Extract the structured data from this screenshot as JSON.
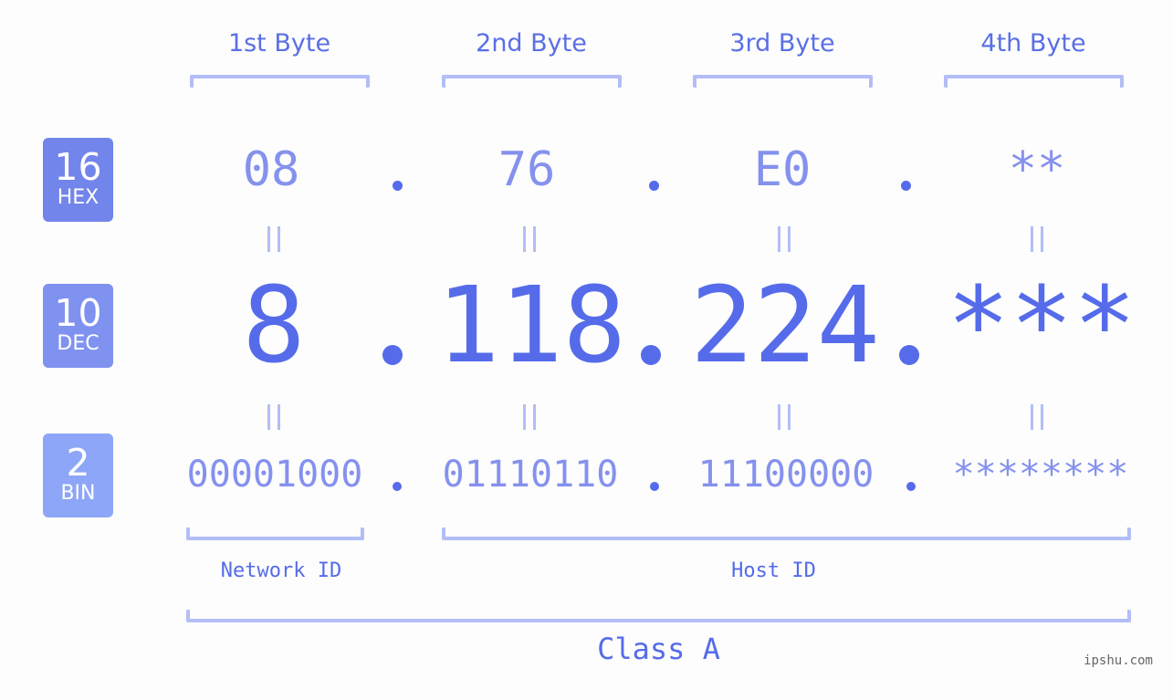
{
  "ip_display": {
    "byte_headers": [
      "1st Byte",
      "2nd Byte",
      "3rd Byte",
      "4th Byte"
    ],
    "bases": [
      {
        "number": "16",
        "label": "HEX",
        "color": "#7285eb"
      },
      {
        "number": "10",
        "label": "DEC",
        "color": "#8092f0"
      },
      {
        "number": "2",
        "label": "BIN",
        "color": "#8ea6f7"
      }
    ],
    "hex": [
      "08",
      "76",
      "E0",
      "**"
    ],
    "dec": [
      "8",
      "118",
      "224",
      "***"
    ],
    "bin": [
      "00001000",
      "01110110",
      "11100000",
      "********"
    ],
    "network_id_label": "Network ID",
    "host_id_label": "Host ID",
    "class_label": "Class A",
    "watermark": "ipshu.com"
  },
  "colors": {
    "accent": "#566bea",
    "light_value": "#8591ee",
    "bracket": "#b3bdf7",
    "background": "#fcfdfc"
  }
}
